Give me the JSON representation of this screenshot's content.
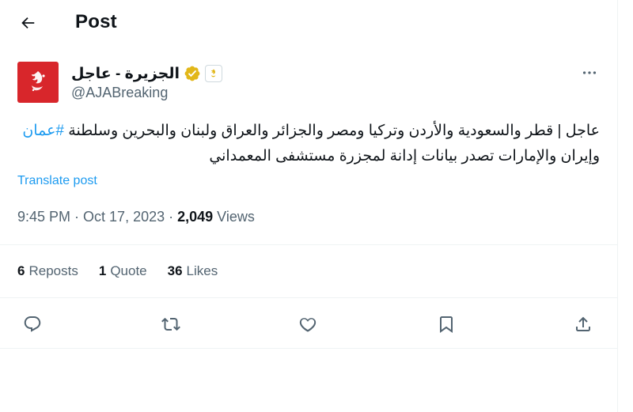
{
  "header": {
    "title": "Post"
  },
  "author": {
    "name": "الجزيرة - عاجل",
    "handle": "@AJABreaking",
    "brand_color": "#d8262b"
  },
  "tweet": {
    "text_main": "عاجل | قطر والسعودية والأردن وتركيا ومصر والجزائر والعراق ولبنان والبحرين وسلطنة ",
    "hashtag": "#عمان",
    "text_rest": " وإيران والإمارات تصدر بيانات إدانة لمجزرة مستشفى المعمداني"
  },
  "translate_label": "Translate post",
  "meta": {
    "time": "9:45 PM",
    "separator": " · ",
    "date": "Oct 17, 2023",
    "views_count": "2,049",
    "views_label": " Views"
  },
  "stats": {
    "reposts_count": "6",
    "reposts_label": "Reposts",
    "quote_count": "1",
    "quote_label": "Quote",
    "likes_count": "36",
    "likes_label": "Likes"
  },
  "icons": {
    "back": "arrow-left-icon",
    "verified": "gold-verified-icon",
    "more": "more-icon",
    "reply": "reply-icon",
    "repost": "repost-icon",
    "like": "heart-icon",
    "bookmark": "bookmark-icon",
    "share": "share-icon"
  },
  "colors": {
    "link": "#1d9bf0",
    "muted": "#536471",
    "text": "#0f1419",
    "verified_gold": "#e2b719"
  }
}
